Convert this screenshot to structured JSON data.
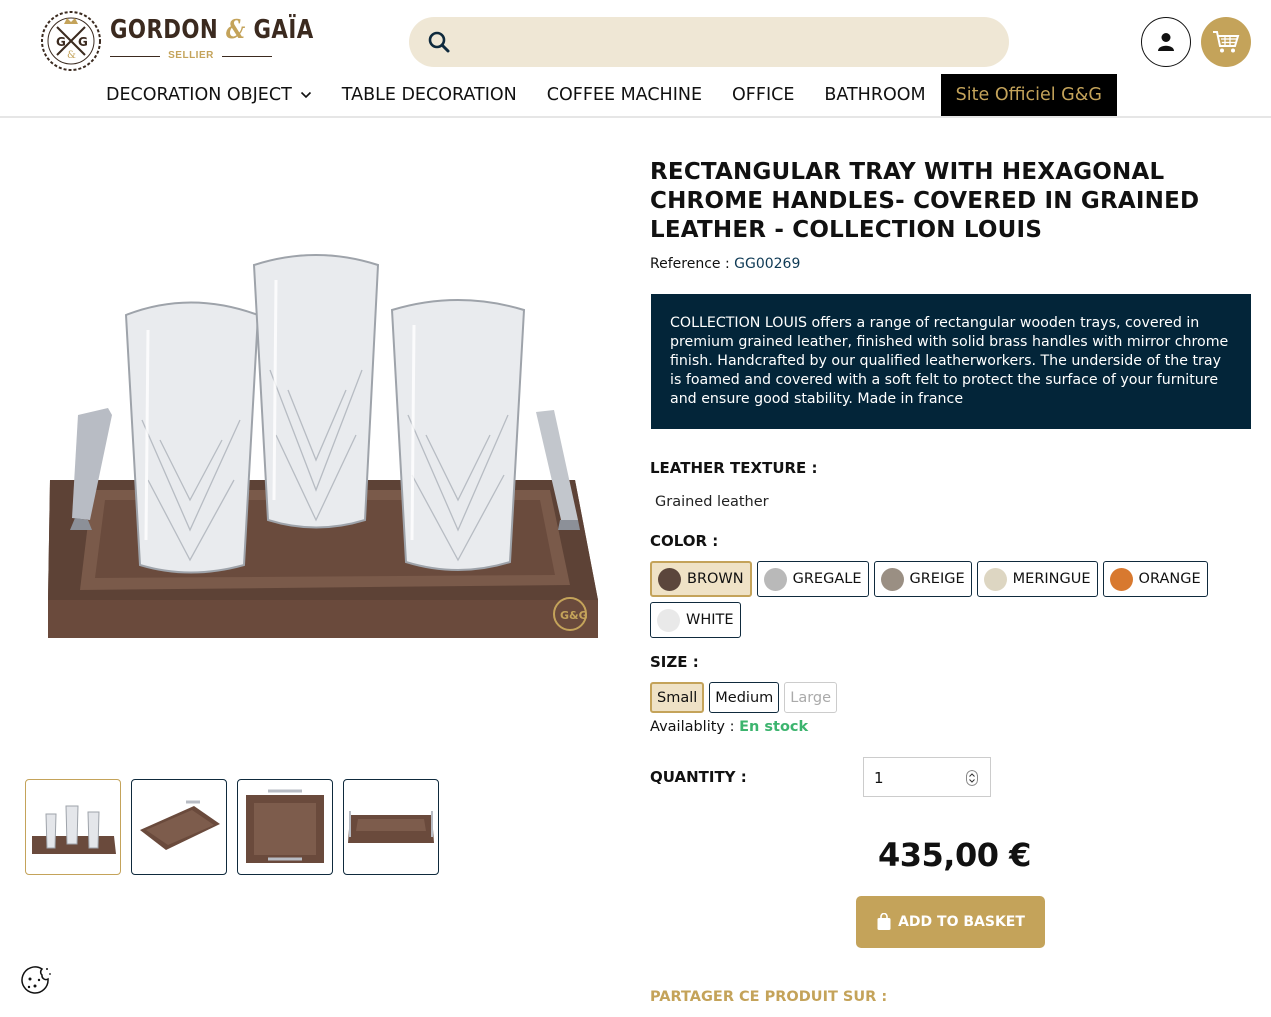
{
  "brand": {
    "name_part1": "GORDON",
    "ampersand": "&",
    "name_part2": "GAÏA",
    "subtitle": "SELLIER",
    "emblem_text": "G&G"
  },
  "search": {
    "placeholder": ""
  },
  "nav": {
    "items": [
      {
        "label": "DECORATION OBJECT"
      },
      {
        "label": "TABLE DECORATION"
      },
      {
        "label": "COFFEE MACHINE"
      },
      {
        "label": "OFFICE"
      },
      {
        "label": "BATHROOM"
      },
      {
        "label": "Site Officiel G&G"
      }
    ]
  },
  "product": {
    "title": "RECTANGULAR TRAY WITH HEXAGONAL CHROME HANDLES- COVERED IN GRAINED LEATHER - COLLECTION LOUIS",
    "reference_label": "Reference :",
    "reference_value": "GG00269",
    "description": "COLLECTION LOUIS offers a range of rectangular wooden trays, covered in premium grained leather, finished with solid brass handles with mirror chrome finish. Handcrafted by our qualified leatherworkers. The underside of the tray is foamed and covered with a soft felt to protect the surface of your furniture and ensure good stability. Made in france",
    "texture_label": "LEATHER TEXTURE :",
    "texture_value": "Grained leather",
    "color_label": "COLOR :",
    "colors": [
      {
        "name": "BROWN",
        "hex": "#5b463c",
        "selected": true
      },
      {
        "name": "GREGALE",
        "hex": "#b9b9b9",
        "selected": false
      },
      {
        "name": "GREIGE",
        "hex": "#9a8f83",
        "selected": false
      },
      {
        "name": "MERINGUE",
        "hex": "#ddd6c2",
        "selected": false
      },
      {
        "name": "ORANGE",
        "hex": "#d8792f",
        "selected": false
      },
      {
        "name": "WHITE",
        "hex": "#e9e9e9",
        "selected": false
      }
    ],
    "size_label": "SIZE :",
    "sizes": [
      {
        "name": "Small",
        "state": "selected"
      },
      {
        "name": "Medium",
        "state": "available"
      },
      {
        "name": "Large",
        "state": "disabled"
      }
    ],
    "availability_label": "Availablity :",
    "availability_value": "En stock",
    "quantity_label": "QUANTITY :",
    "quantity_value": "1",
    "price": "435,00 €",
    "add_to_basket": "ADD TO BASKET",
    "share_label": "PARTAGER CE PRODUIT SUR :"
  },
  "colors": {
    "gold": "#c4a35a",
    "navy": "#032539",
    "stock_green": "#3cb46e",
    "search_bg": "#efe7d5"
  }
}
